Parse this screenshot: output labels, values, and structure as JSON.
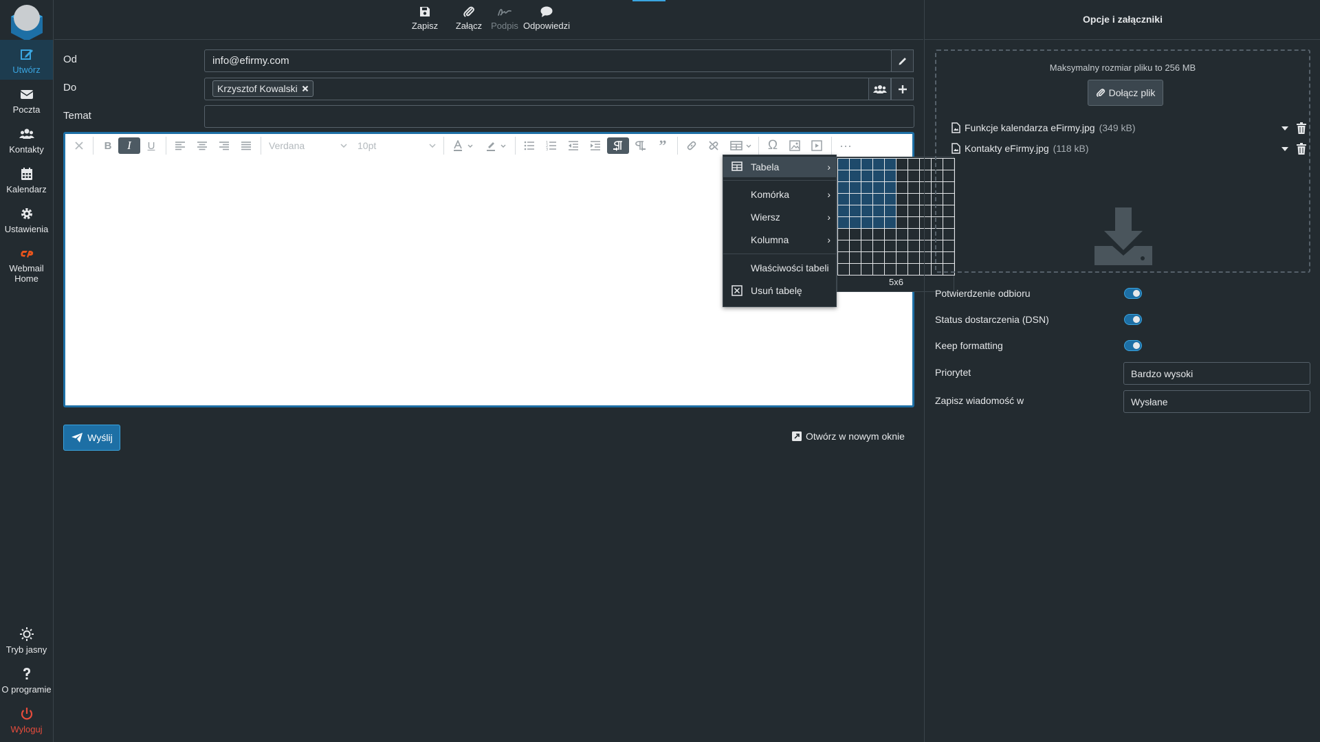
{
  "rail": {
    "items": [
      {
        "label": "Utwórz"
      },
      {
        "label": "Poczta"
      },
      {
        "label": "Kontakty"
      },
      {
        "label": "Kalendarz"
      },
      {
        "label": "Ustawienia"
      },
      {
        "label": "Webmail Home"
      }
    ],
    "bottom": [
      {
        "label": "Tryb jasny"
      },
      {
        "label": "O programie"
      },
      {
        "label": "Wyloguj"
      }
    ]
  },
  "toolbar": {
    "save": "Zapisz",
    "attach": "Załącz",
    "signature": "Podpis",
    "responses": "Odpowiedzi"
  },
  "compose": {
    "from_label": "Od",
    "from_value": "info@efirmy.com",
    "to_label": "Do",
    "recipient": "Krzysztof Kowalski",
    "subject_label": "Temat",
    "subject_value": ""
  },
  "editor": {
    "font": "Verdana",
    "size": "10pt"
  },
  "table_menu": {
    "items": {
      "table": "Tabela",
      "cell": "Komórka",
      "row": "Wiersz",
      "column": "Kolumna",
      "properties": "Właściwości tabeli",
      "delete": "Usuń tabelę"
    },
    "grid_selection": "5x6"
  },
  "actions": {
    "send": "Wyślij",
    "open_new": "Otwórz w nowym oknie"
  },
  "right_panel": {
    "title": "Opcje i załączniki",
    "max_size": "Maksymalny rozmiar pliku to 256 MB",
    "attach_button": "Dołącz plik",
    "files": [
      {
        "name": "Funkcje kalendarza eFirmy.jpg",
        "size": "(349 kB)"
      },
      {
        "name": "Kontakty eFirmy.jpg",
        "size": "(118 kB)"
      }
    ],
    "options": {
      "read_receipt": "Potwierdzenie odbioru",
      "dsn": "Status dostarczenia (DSN)",
      "keep_formatting": "Keep formatting",
      "priority_label": "Priorytet",
      "priority_value": "Bardzo wysoki",
      "save_in_label": "Zapisz wiadomość w",
      "save_in_value": "Wysłane"
    }
  },
  "colors": {
    "accent": "#3aa5e0",
    "accent_dark": "#1d6fa5",
    "background": "#232b30",
    "danger": "#e74c3c",
    "brand_orange": "#e8541c"
  }
}
